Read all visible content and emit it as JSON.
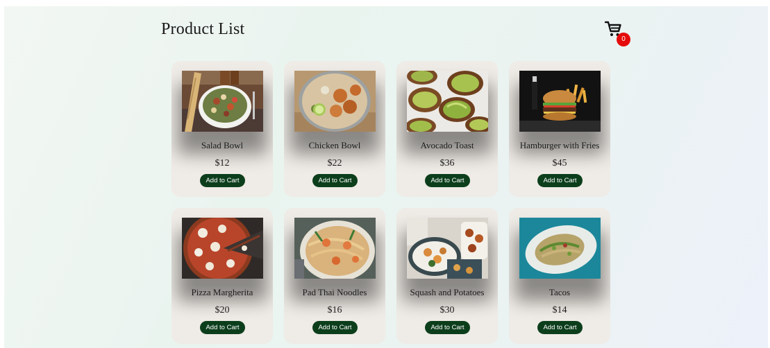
{
  "header": {
    "title": "Product List",
    "cart_count": "0",
    "cart_icon": "cart-icon"
  },
  "colors": {
    "button_bg": "#0c3e1c",
    "badge_bg": "#e50b0b",
    "card_bg": "#efebe6"
  },
  "products": [
    {
      "name": "Salad Bowl",
      "price": "$12",
      "button_label": "Add to Cart",
      "image": "salad-bowl-image"
    },
    {
      "name": "Chicken Bowl",
      "price": "$22",
      "button_label": "Add to Cart",
      "image": "chicken-bowl-image"
    },
    {
      "name": "Avocado Toast",
      "price": "$36",
      "button_label": "Add to Cart",
      "image": "avocado-toast-image"
    },
    {
      "name": "Hamburger with Fries",
      "price": "$45",
      "button_label": "Add to Cart",
      "image": "hamburger-image"
    },
    {
      "name": "Pizza Margherita",
      "price": "$20",
      "button_label": "Add to Cart",
      "image": "pizza-image"
    },
    {
      "name": "Pad Thai Noodles",
      "price": "$16",
      "button_label": "Add to Cart",
      "image": "pad-thai-image"
    },
    {
      "name": "Squash and Potatoes",
      "price": "$30",
      "button_label": "Add to Cart",
      "image": "squash-potatoes-image"
    },
    {
      "name": "Tacos",
      "price": "$14",
      "button_label": "Add to Cart",
      "image": "tacos-image"
    }
  ]
}
